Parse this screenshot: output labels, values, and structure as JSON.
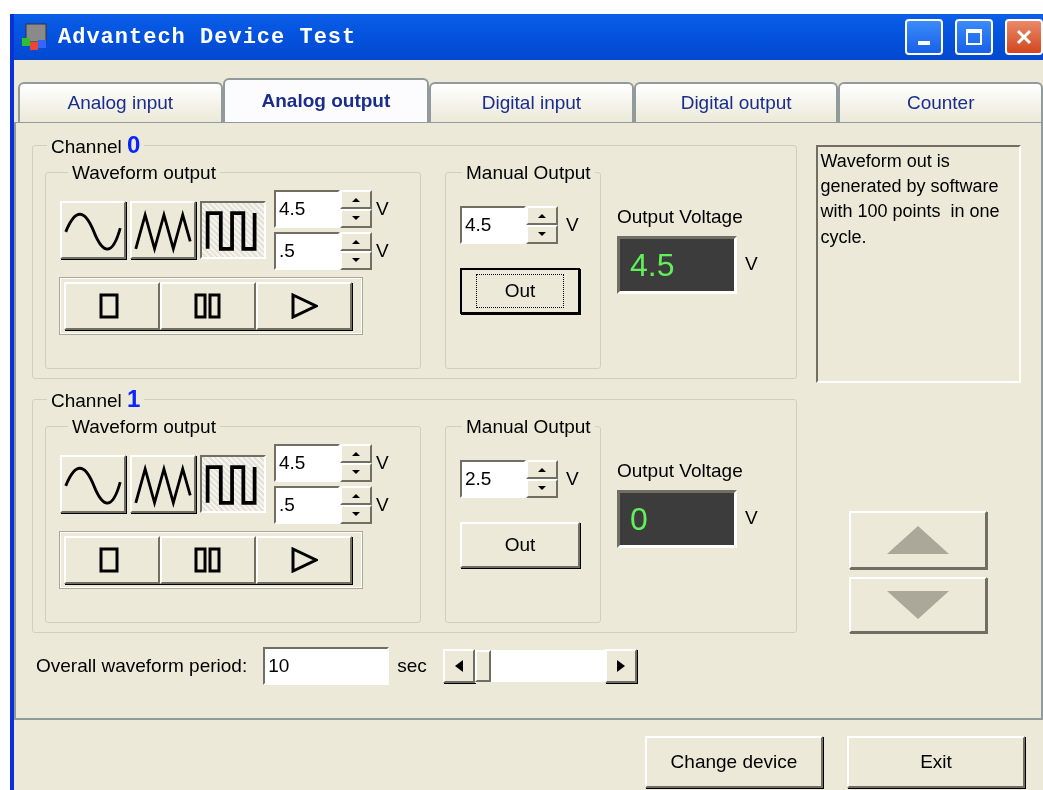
{
  "window": {
    "title": "Advantech Device Test"
  },
  "tabs": [
    {
      "label": "Analog input",
      "selected": false
    },
    {
      "label": "Analog output",
      "selected": true
    },
    {
      "label": "Digital input",
      "selected": false
    },
    {
      "label": "Digital output",
      "selected": false
    },
    {
      "label": "Counter",
      "selected": false
    }
  ],
  "channels": [
    {
      "label": "Channel",
      "number": "0",
      "waveform_title": "Waveform output",
      "waveforms": [
        {
          "kind": "sine",
          "selected": false
        },
        {
          "kind": "triangle",
          "selected": false
        },
        {
          "kind": "square",
          "selected": true
        }
      ],
      "high": {
        "value": "4.5",
        "unit": "V"
      },
      "low": {
        "value": ".5",
        "unit": "V"
      },
      "manual": {
        "title": "Manual Output",
        "value": "4.5",
        "unit": "V",
        "button": "Out",
        "focused": true
      },
      "output": {
        "title": "Output Voltage",
        "reading": "4.5",
        "unit": "V"
      }
    },
    {
      "label": "Channel",
      "number": "1",
      "waveform_title": "Waveform output",
      "waveforms": [
        {
          "kind": "sine",
          "selected": false
        },
        {
          "kind": "triangle",
          "selected": false
        },
        {
          "kind": "square",
          "selected": true
        }
      ],
      "high": {
        "value": "4.5",
        "unit": "V"
      },
      "low": {
        "value": ".5",
        "unit": "V"
      },
      "manual": {
        "title": "Manual Output",
        "value": "2.5",
        "unit": "V",
        "button": "Out",
        "focused": false
      },
      "output": {
        "title": "Output Voltage",
        "reading": "0",
        "unit": "V"
      }
    }
  ],
  "info": "Waveform out is generated by software with 100 points  in one cycle.",
  "period": {
    "label": "Overall waveform period:",
    "value": "10",
    "unit": "sec",
    "level": 0
  },
  "buttons": [
    {
      "label": "Change device"
    },
    {
      "label": "Exit"
    }
  ]
}
